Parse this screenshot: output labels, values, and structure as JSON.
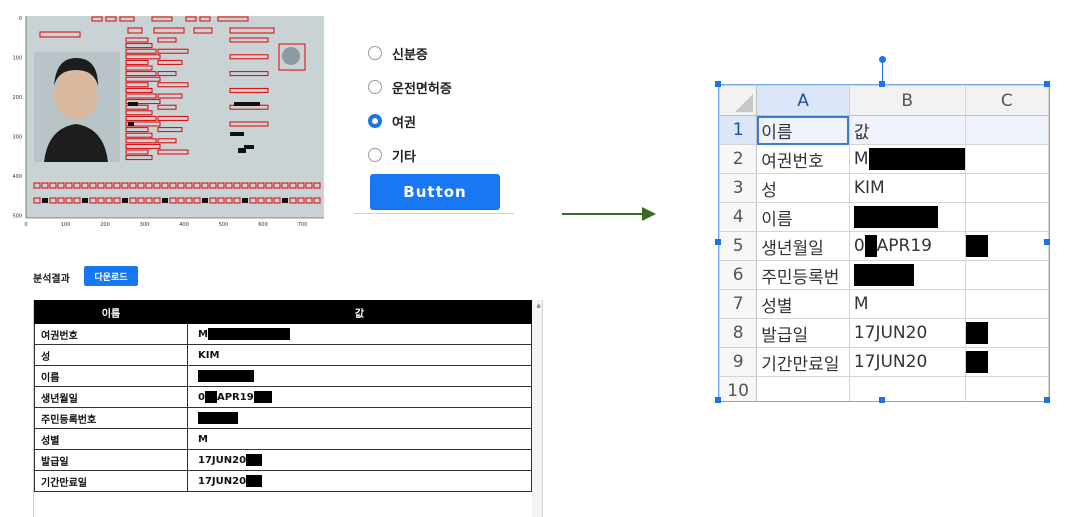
{
  "options": [
    {
      "label": "신분증",
      "checked": false
    },
    {
      "label": "운전면허증",
      "checked": false
    },
    {
      "label": "여권",
      "checked": true
    },
    {
      "label": "기타",
      "checked": false
    }
  ],
  "button_label": "Button",
  "result": {
    "title": "분석결과",
    "download_label": "다운로드",
    "columns": [
      "이름",
      "값"
    ],
    "rows": [
      {
        "name": "여권번호",
        "value": "M",
        "redacted": true
      },
      {
        "name": "성",
        "value": "KIM",
        "redacted": false
      },
      {
        "name": "이름",
        "value": "",
        "redacted": true
      },
      {
        "name": "생년월일",
        "value": "0",
        "value_after": "APR19",
        "redacted": true
      },
      {
        "name": "주민등록번호",
        "value": "",
        "redacted": true
      },
      {
        "name": "성별",
        "value": "M",
        "redacted": false
      },
      {
        "name": "발급일",
        "value": "17JUN20",
        "redacted": true
      },
      {
        "name": "기간만료일",
        "value": "17JUN20",
        "redacted": true
      }
    ]
  },
  "plot": {
    "x_ticks": [
      "0",
      "100",
      "200",
      "300",
      "400",
      "500",
      "600",
      "700"
    ],
    "y_ticks": [
      "0",
      "100",
      "200",
      "300",
      "400",
      "500"
    ]
  },
  "sheet": {
    "columns": [
      "A",
      "B",
      "C"
    ],
    "rows": [
      {
        "n": "1",
        "a": "이름",
        "b": "값"
      },
      {
        "n": "2",
        "a": "여권번호",
        "b": "M"
      },
      {
        "n": "3",
        "a": "성",
        "b": "KIM"
      },
      {
        "n": "4",
        "a": "이름",
        "b": ""
      },
      {
        "n": "5",
        "a": "생년월일",
        "b": "0",
        "b_after": "APR19"
      },
      {
        "n": "6",
        "a": "주민등록번",
        "b": ""
      },
      {
        "n": "7",
        "a": "성별",
        "b": "M"
      },
      {
        "n": "8",
        "a": "발급일",
        "b": "17JUN20"
      },
      {
        "n": "9",
        "a": "기간만료일",
        "b": "17JUN20"
      },
      {
        "n": "10",
        "a": "",
        "b": ""
      }
    ]
  }
}
